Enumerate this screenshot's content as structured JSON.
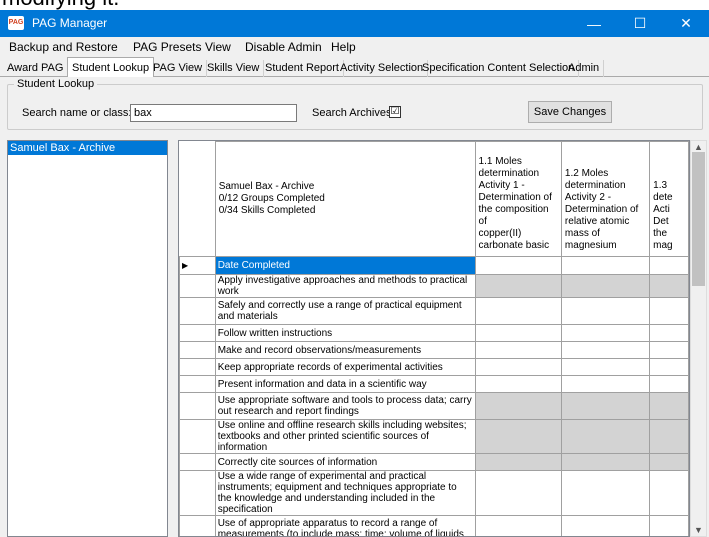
{
  "top_fragment": "modifying it.",
  "window": {
    "title": "PAG Manager",
    "app_icon": "PAG",
    "minimize_glyph": "—",
    "maximize_glyph": "☐",
    "close_glyph": "✕"
  },
  "menu": [
    "Backup and Restore",
    "PAG Presets",
    "View",
    "Disable Admin",
    "Help"
  ],
  "tabs": [
    "Award PAG",
    "Student Lookup",
    "PAG View",
    "Skills View",
    "Student Report",
    "Activity Selection",
    "Specification Content Selection",
    "Admin"
  ],
  "active_tab": "Student Lookup",
  "lookup": {
    "group_title": "Student Lookup",
    "search_label": "Search name or class:",
    "search_value": "bax",
    "archives_label": "Search Archives",
    "archives_checked": "☑",
    "save_label": "Save Changes"
  },
  "results": [
    "Samuel Bax - Archive"
  ],
  "grid": {
    "student_header": "Samuel Bax - Archive\n 0/12 Groups Completed\n 0/34 Skills Completed",
    "columns": [
      "1.1 Moles\ndetermination\nActivity 1 -\nDetermination of\nthe composition of\ncopper(II)\ncarbonate basic",
      "1.2 Moles\ndetermination\nActivity 2 -\nDetermination of\nrelative atomic\nmass of\nmagnesium",
      "1.3\ndete\nActi\nDet\nthe\nmag"
    ],
    "row_marker": "▶",
    "rows": [
      "Date Completed",
      "Apply investigative approaches and methods to practical work",
      "Safely and correctly use a range of practical equipment and materials",
      "Follow written instructions",
      "Make and record observations/measurements",
      "Keep appropriate records of experimental activities",
      "Present information and data in a scientific way",
      "Use appropriate software and tools to process data; carry out research and report findings",
      "Use online and offline research skills including websites; textbooks and other printed scientific sources of information",
      "Correctly cite sources of information",
      "Use a wide range of experimental and practical instruments; equipment and techniques appropriate to the knowledge and understanding included in the specification",
      "Use of appropriate apparatus to record a range of measurements (to include mass; time; volume of liquids and gases; temperature)"
    ]
  },
  "scroll": {
    "up": "▲",
    "down": "▼"
  },
  "colors": {
    "titlebar": "#0078d7",
    "selection": "#0078d7",
    "disabled_cell": "#d3d3d3"
  }
}
